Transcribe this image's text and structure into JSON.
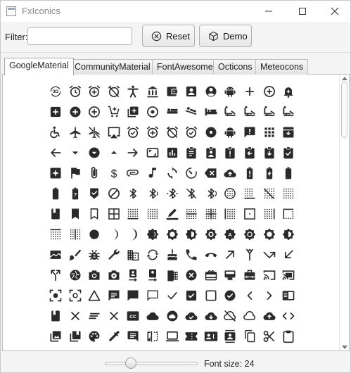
{
  "window": {
    "title": "FxIconics"
  },
  "toolbar": {
    "filter_label": "Filter:",
    "filter_value": "",
    "filter_placeholder": "",
    "reset_label": "Reset",
    "demo_label": "Demo"
  },
  "tabs": [
    {
      "label": "GoogleMaterial",
      "active": true
    },
    {
      "label": "CommunityMaterial",
      "active": false
    },
    {
      "label": "FontAwesome",
      "active": false
    },
    {
      "label": "Octicons",
      "active": false
    },
    {
      "label": "Meteocons",
      "active": false
    }
  ],
  "icons": [
    "3d-rotation",
    "alarm",
    "alarm-add",
    "alarm-off",
    "accessibility",
    "account-balance",
    "account-balance-wallet",
    "account-box",
    "account-circle",
    "android",
    "add",
    "add-circle-outline",
    "add-alert",
    "add-box",
    "add-circle",
    "control-point",
    "add-shopping-cart",
    "add-to-photos",
    "adjust",
    "airline-seat-flat",
    "airline-seat-flat-angled",
    "airline-seat-individual-suite",
    "airline-seat-legroom-extra",
    "airline-seat-legroom-normal",
    "airline-seat-legroom-reduced",
    "airline-seat-recline-extra",
    "accessible",
    "airplanemode-active",
    "airplanemode-inactive",
    "airplay",
    "alarm-on",
    "alarm-add-2",
    "alarm-off-2",
    "alarm-check",
    "album",
    "android-2",
    "announcement",
    "apps",
    "archive",
    "arrow-back",
    "arrow-drop-down",
    "arrow-drop-down-circle",
    "arrow-drop-up",
    "arrow-forward",
    "aspect-ratio",
    "assessment",
    "assignment",
    "assignment-ind",
    "assignment-late",
    "assignment-return",
    "assignment-returned",
    "assignment-turned-in",
    "assistant",
    "assistant-photo",
    "attach-file",
    "attach-money",
    "attachment",
    "audiotrack",
    "autorenew",
    "av-timer",
    "backspace",
    "backup",
    "battery-alert",
    "battery-charging-full",
    "battery-full",
    "battery-std",
    "battery-unknown",
    "beenhere",
    "block",
    "bluetooth",
    "bluetooth-audio",
    "bluetooth-connected",
    "bluetooth-disabled",
    "bluetooth-searching",
    "blur-circular",
    "blur-linear",
    "blur-off",
    "blur-on",
    "book",
    "bookmark",
    "bookmark-border",
    "border-all",
    "border-bottom",
    "border-clear",
    "border-color",
    "border-horizontal",
    "border-inner",
    "border-left",
    "border-outer",
    "border-right",
    "border-style",
    "border-top",
    "border-vertical",
    "brightness-1",
    "brightness-2",
    "brightness-3",
    "brightness-4",
    "brightness-5",
    "brightness-6",
    "brightness-7",
    "brightness-auto",
    "brightness-high",
    "brightness-low",
    "brightness-medium",
    "broken-image",
    "brush",
    "bug-report",
    "build",
    "business",
    "cached",
    "cake",
    "call",
    "call-end",
    "call-made",
    "call-merge",
    "call-missed",
    "call-received",
    "call-split",
    "camera",
    "camera-alt",
    "camera-enhance",
    "camera-front",
    "camera-rear",
    "camera-roll",
    "cancel",
    "card-giftcard",
    "card-membership",
    "card-travel",
    "cast",
    "cast-connected",
    "center-focus-strong",
    "center-focus-weak",
    "change-history",
    "chat",
    "chat-bubble",
    "chat-bubble-outline",
    "check",
    "check-box",
    "check-box-outline-blank",
    "check-circle",
    "chevron-left",
    "chevron-right",
    "chrome-reader-mode",
    "class",
    "clear",
    "clear-all",
    "close",
    "closed-caption",
    "cloud",
    "cloud-circle",
    "cloud-done",
    "cloud-download",
    "cloud-off",
    "cloud-queue",
    "cloud-upload",
    "code",
    "collections",
    "collections-bookmark",
    "color-lens",
    "colorize",
    "comment",
    "compare",
    "computer",
    "confirmation-number",
    "contact-phone",
    "contacts",
    "content-copy",
    "content-cut",
    "content-paste"
  ],
  "footer": {
    "font_size_label": "Font size: 24",
    "slider_value": 24
  }
}
